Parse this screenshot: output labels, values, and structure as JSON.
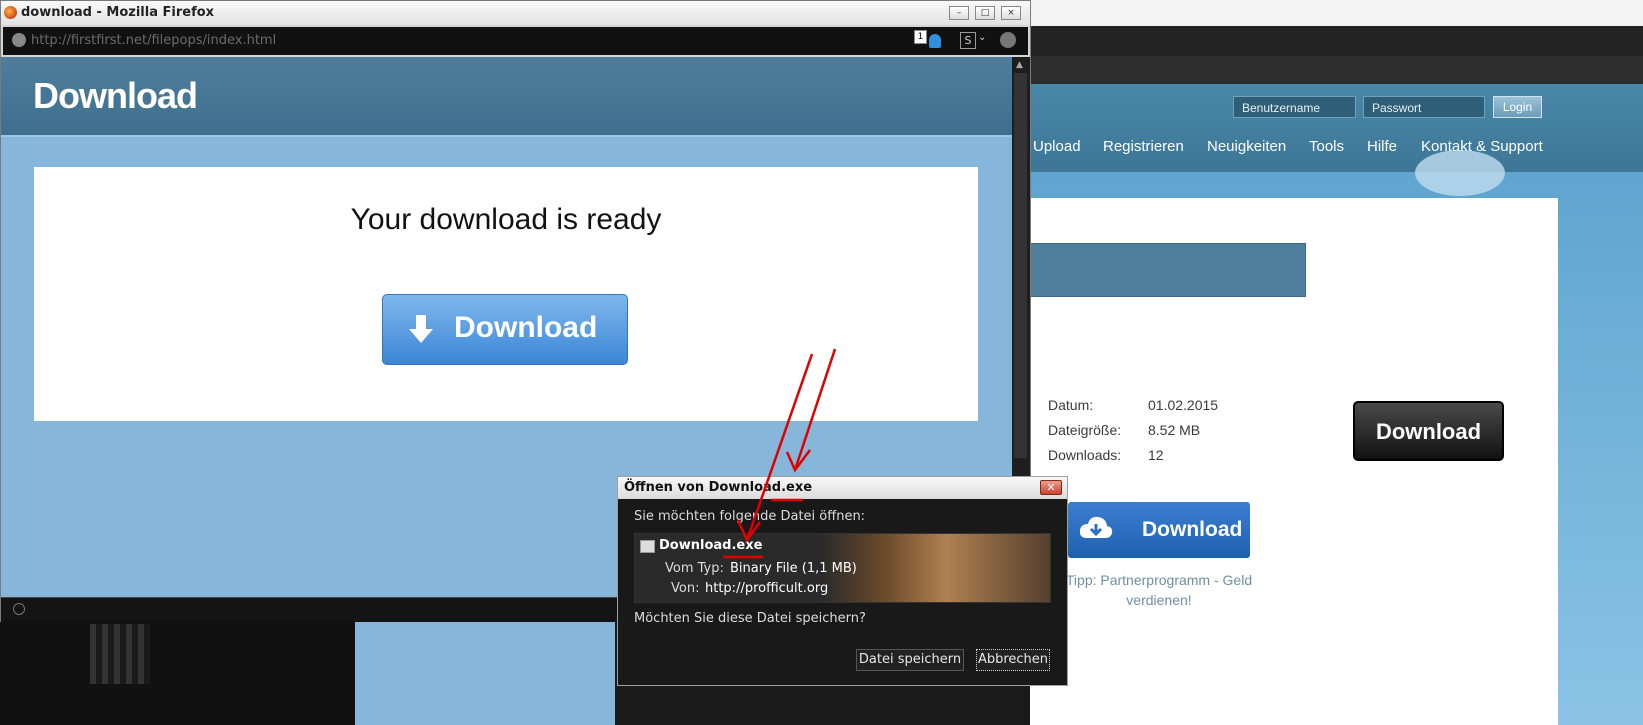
{
  "firefox": {
    "title": "download - Mozilla Firefox",
    "url": "http://firstfirst.net/filepops/index.html",
    "tab_count": "1",
    "page": {
      "brand": "Download",
      "heading": "Your download is ready",
      "download_button": "Download"
    }
  },
  "background_site": {
    "username_placeholder": "Benutzername",
    "password_placeholder": "Passwort",
    "login_label": "Login",
    "nav": [
      "Upload",
      "Registrieren",
      "Neuigkeiten",
      "Tools",
      "Hilfe",
      "Kontakt & Support"
    ],
    "info": [
      {
        "label": "Datum:",
        "value": "01.02.2015"
      },
      {
        "label": "Dateigröße:",
        "value": "8.52 MB"
      },
      {
        "label": "Downloads:",
        "value": "12"
      }
    ],
    "download_black": "Download",
    "download_blue": "Download",
    "tipp": "Tipp: Partnerprogramm - Geld verdienen!"
  },
  "dialog": {
    "title": "Öffnen von Download.exe",
    "prompt": "Sie möchten folgende Datei öffnen:",
    "filename": "Download.exe",
    "type_label": "Vom Typ:",
    "type_value": "Binary File (1,1 MB)",
    "from_label": "Von:",
    "from_value": "http://profficult.org",
    "question": "Möchten Sie diese Datei speichern?",
    "save_button": "Datei speichern",
    "cancel_button": "Abbrechen"
  },
  "colors": {
    "page_bg": "#86b7da",
    "header_bg": "#4e7e9c",
    "dialog_bg": "#191919",
    "annotation": "#e00000"
  }
}
